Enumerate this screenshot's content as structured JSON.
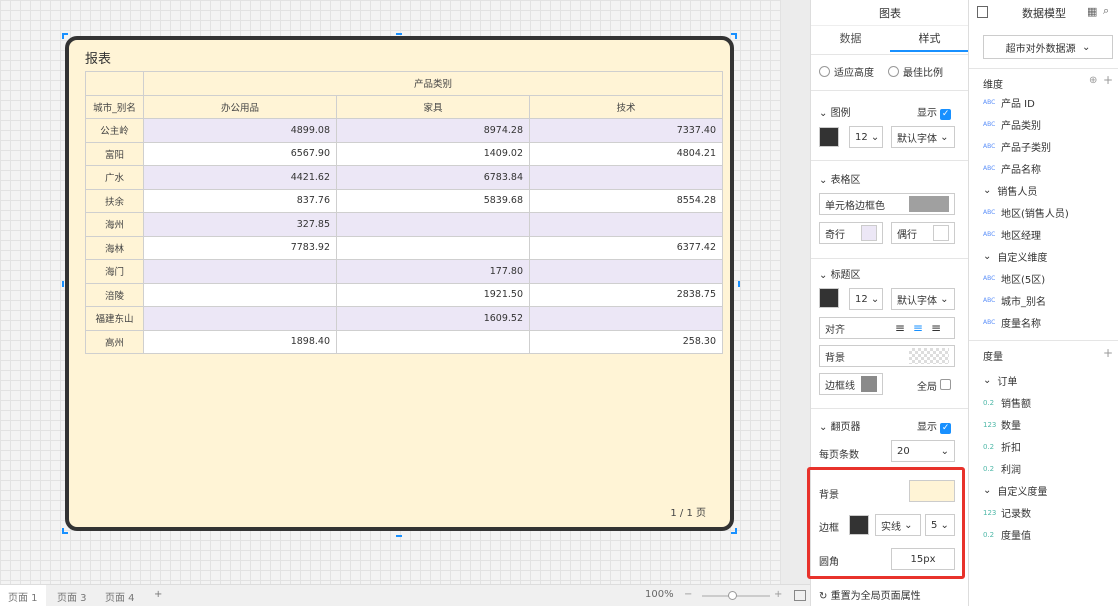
{
  "report": {
    "title": "报表",
    "pager": "1 / 1 页"
  },
  "table": {
    "group_header": "产品类别",
    "row_header": "城市_别名",
    "columns": [
      "办公用品",
      "家具",
      "技术"
    ],
    "rows": [
      {
        "city": "公主岭",
        "values": [
          "4899.08",
          "8974.28",
          "7337.40"
        ]
      },
      {
        "city": "富阳",
        "values": [
          "6567.90",
          "1409.02",
          "4804.21"
        ]
      },
      {
        "city": "广水",
        "values": [
          "4421.62",
          "6783.84",
          ""
        ]
      },
      {
        "city": "扶余",
        "values": [
          "837.76",
          "5839.68",
          "8554.28"
        ]
      },
      {
        "city": "海州",
        "values": [
          "327.85",
          "",
          ""
        ]
      },
      {
        "city": "海林",
        "values": [
          "7783.92",
          "",
          "6377.42"
        ]
      },
      {
        "city": "海门",
        "values": [
          "",
          "177.80",
          ""
        ]
      },
      {
        "city": "涪陵",
        "values": [
          "",
          "1921.50",
          "2838.75"
        ]
      },
      {
        "city": "福建东山",
        "values": [
          "",
          "1609.52",
          ""
        ]
      },
      {
        "city": "高州",
        "values": [
          "1898.40",
          "",
          "258.30"
        ]
      }
    ]
  },
  "tabs": [
    "页面 1",
    "页面 3",
    "页面 4",
    "+"
  ],
  "zoom": "100%",
  "panel": {
    "title": "图表",
    "tab_data": "数据",
    "tab_style": "样式",
    "fit_height": "适应高度",
    "best_ratio": "最佳比例",
    "legend": "图例",
    "show": "显示",
    "font_size": "12",
    "font": "默认字体",
    "table_area": "表格区",
    "cell_border": "单元格边框色",
    "odd": "奇行",
    "even": "偶行",
    "title_area": "标题区",
    "align": "对齐",
    "bg": "背景",
    "border_line": "边框线",
    "global": "全局",
    "pager": "翻页器",
    "per_page": "每页条数",
    "per_page_val": "20",
    "bg2": "背景",
    "border": "边框",
    "solid": "实线",
    "width": "5",
    "radius": "圆角",
    "radius_val": "15px",
    "reset": "重置为全局页面属性"
  },
  "datamodel": {
    "title": "数据模型",
    "source": "超市对外数据源",
    "dim": "维度",
    "measure": "度量",
    "dims": [
      "产品 ID",
      "产品类别",
      "产品子类别",
      "产品名称"
    ],
    "sales_person": "销售人员",
    "sp_items": [
      "地区(销售人员)",
      "地区经理"
    ],
    "custom_dim": "自定义维度",
    "cd_items": [
      "地区(5区)",
      "城市_别名",
      "度量名称"
    ],
    "order": "订单",
    "measures": [
      {
        "t": "0.2",
        "n": "销售额"
      },
      {
        "t": "123",
        "n": "数量"
      },
      {
        "t": "0.2",
        "n": "折扣"
      },
      {
        "t": "0.2",
        "n": "利润"
      }
    ],
    "custom_measure": "自定义度量",
    "cm_items": [
      {
        "t": "123",
        "n": "记录数"
      },
      {
        "t": "0.2",
        "n": "度量值"
      }
    ]
  },
  "colors": {
    "accent": "#1890ff",
    "highlight": "#e8322b",
    "report_bg": "#fff4d6"
  }
}
